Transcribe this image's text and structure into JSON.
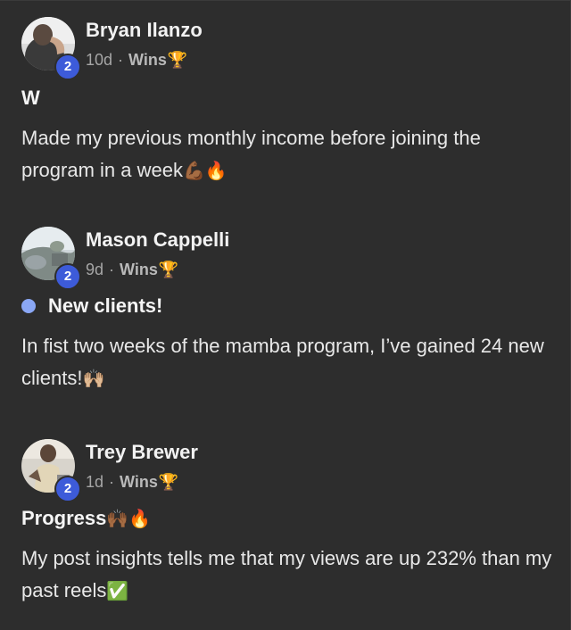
{
  "posts": [
    {
      "author": "Bryan Ilanzo",
      "level": "2",
      "age": "10d",
      "separator": "·",
      "category": "Wins",
      "category_emoji": "🏆",
      "title": "W",
      "body_text": "Made my previous monthly income before joining the program in a week",
      "body_emoji": "💪🏾🔥"
    },
    {
      "author": "Mason Cappelli",
      "level": "2",
      "age": "9d",
      "separator": "·",
      "category": "Wins",
      "category_emoji": "🏆",
      "title": "New clients!",
      "body_text": "In fist two weeks of the mamba program, I’ve gained 24 new clients!",
      "body_emoji": "🙌🏼"
    },
    {
      "author": "Trey Brewer",
      "level": "2",
      "age": "1d",
      "separator": "·",
      "category": "Wins",
      "category_emoji": "🏆",
      "title": "Progress",
      "title_emoji": "🙌🏾🔥",
      "body_text": "My post insights tells me that my views are up 232% than my past reels",
      "body_emoji": "✅"
    }
  ],
  "colors": {
    "background": "#2d2d2d",
    "level_badge": "#3d5bd9",
    "new_dot": "#8aa7f5"
  }
}
